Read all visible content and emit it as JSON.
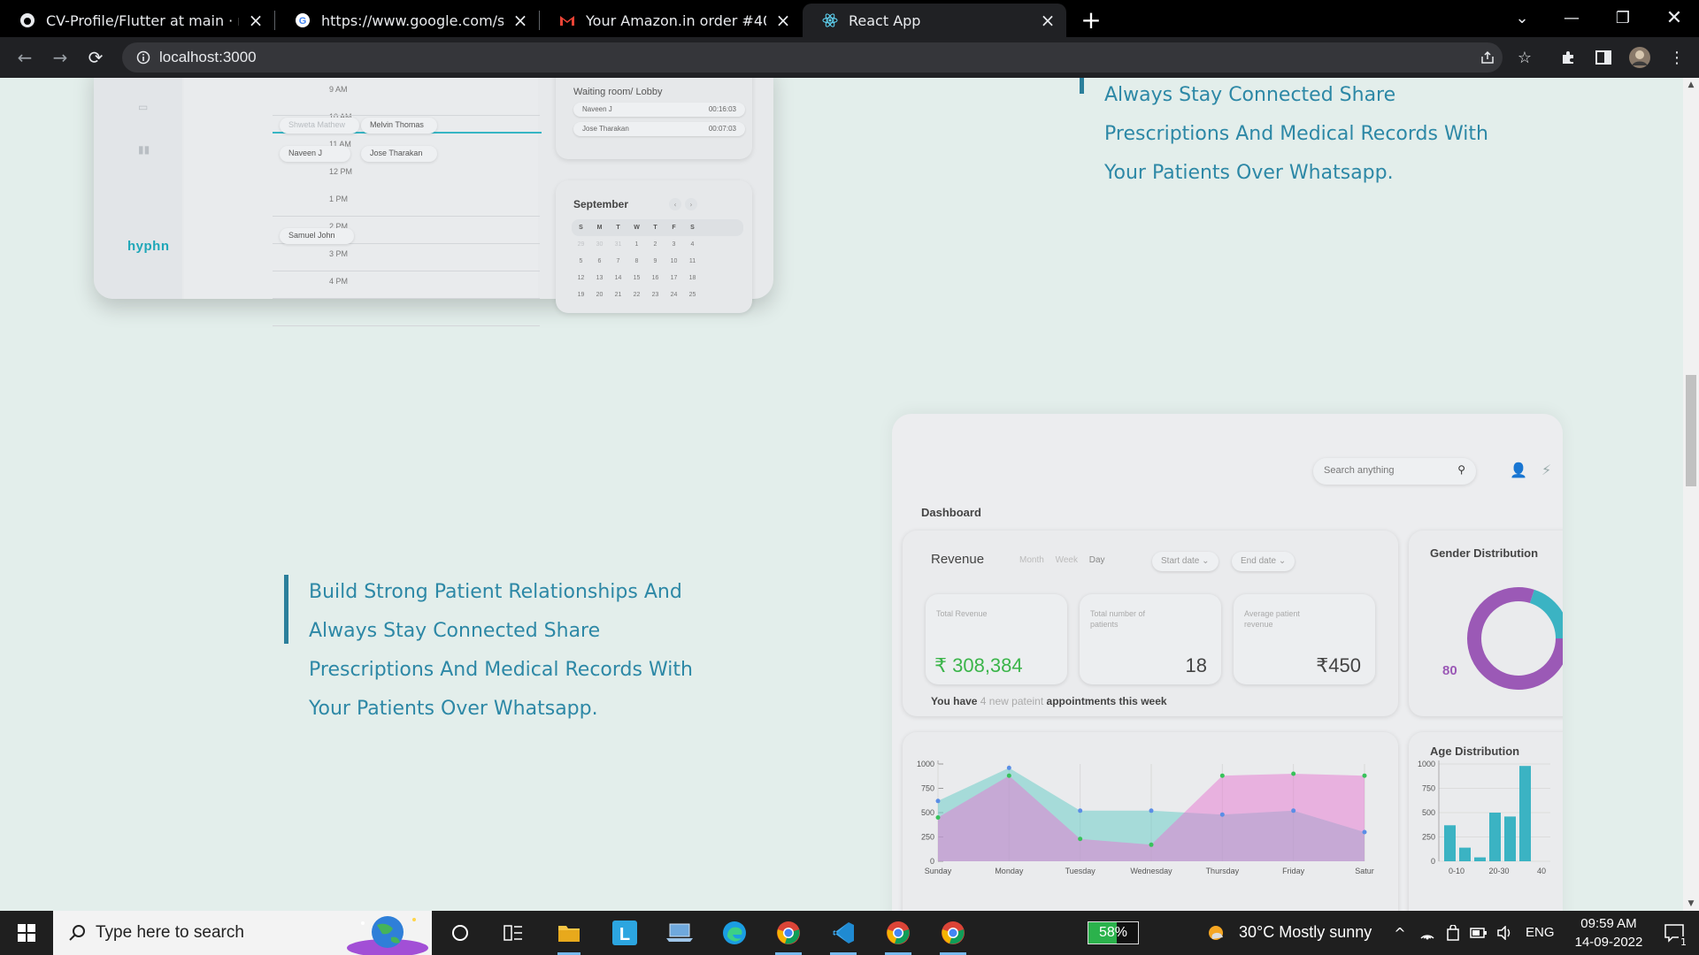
{
  "browser": {
    "tabs": [
      {
        "title": "CV-Profile/Flutter at main · ruben",
        "icon": "github-icon"
      },
      {
        "title": "https://www.google.com/search?",
        "icon": "google-icon"
      },
      {
        "title": "Your Amazon.in order #408-3210",
        "icon": "gmail-icon"
      },
      {
        "title": "React App",
        "icon": "react-icon",
        "active": true
      }
    ],
    "url": "localhost:3000"
  },
  "calendar_mock": {
    "hours": [
      "9 AM",
      "10 AM",
      "11 AM",
      "12 PM",
      "1 PM",
      "2 PM",
      "3 PM",
      "4 PM"
    ],
    "appointments": [
      "Shweta Mathew",
      "Melvin Thomas",
      "Naveen J",
      "Jose Tharakan",
      "Samuel John"
    ],
    "logo": "hyphn",
    "lobby": {
      "title": "Waiting room/ Lobby",
      "rows": [
        {
          "name": "Naveen J",
          "time": "00:16:03"
        },
        {
          "name": "Jose Tharakan",
          "time": "00:07:03"
        }
      ]
    },
    "month": {
      "name": "September",
      "weekdays": [
        "S",
        "M",
        "T",
        "W",
        "T",
        "F",
        "S"
      ],
      "weeks": [
        [
          "29",
          "30",
          "31",
          "1",
          "2",
          "3",
          "4"
        ],
        [
          "5",
          "6",
          "7",
          "8",
          "9",
          "10",
          "11"
        ],
        [
          "12",
          "13",
          "14",
          "15",
          "16",
          "17",
          "18"
        ],
        [
          "19",
          "20",
          "21",
          "22",
          "23",
          "24",
          "25"
        ]
      ]
    }
  },
  "features": {
    "top_lines": [
      "Always Stay Connected Share",
      "Prescriptions And Medical Records With",
      "Your Patients Over Whatsapp."
    ],
    "main_lines": [
      "Build Strong Patient Relationships And",
      "Always Stay Connected Share",
      "Prescriptions And Medical Records With",
      "Your Patients Over Whatsapp."
    ]
  },
  "dashboard_mock": {
    "search_placeholder": "Search anything",
    "title": "Dashboard",
    "revenue": {
      "title": "Revenue",
      "periods": [
        "Month",
        "Week",
        "Day"
      ],
      "start_date": "Start date",
      "end_date": "End date",
      "stats": [
        {
          "label": "Total Revenue",
          "value": "₹ 308,384"
        },
        {
          "label": "Total number of patients",
          "value": "18"
        },
        {
          "label": "Average patient revenue",
          "value": "₹450"
        }
      ],
      "note_prefix": "You have ",
      "note_count": "4 new pateint",
      "note_suffix": " appointments this week"
    },
    "gender": {
      "title": "Gender Distribution",
      "value": "80"
    },
    "age": {
      "title": "Age Distribution"
    }
  },
  "chart_data": [
    {
      "type": "area",
      "categories": [
        "Sunday",
        "Monday",
        "Tuesday",
        "Wednesday",
        "Thursday",
        "Friday",
        "Satur"
      ],
      "yticks": [
        "0",
        "250",
        "500",
        "750",
        "1000"
      ],
      "ylim": [
        0,
        1000
      ],
      "series": [
        {
          "values": [
            620,
            960,
            520,
            520,
            480,
            520,
            300
          ],
          "color": "#5b8ee6"
        },
        {
          "values": [
            450,
            880,
            230,
            170,
            880,
            900,
            880
          ],
          "color": "#38c25b"
        }
      ]
    },
    {
      "type": "bar",
      "xticks": [
        "0-10",
        "20-30",
        "40"
      ],
      "yticks": [
        "0",
        "250",
        "500",
        "750",
        "1000"
      ],
      "ylim": [
        0,
        1000
      ],
      "values": [
        370,
        140,
        40,
        500,
        460,
        980
      ]
    },
    {
      "type": "pie",
      "values": [
        80,
        20
      ],
      "colors": [
        "#9b59b6",
        "#3bb3c3"
      ]
    }
  ],
  "taskbar": {
    "search_placeholder": "Type here to search",
    "battery": "58%",
    "weather": "30°C  Mostly sunny",
    "language": "ENG",
    "time": "09:59 AM",
    "date": "14-09-2022",
    "notifications": "1"
  }
}
